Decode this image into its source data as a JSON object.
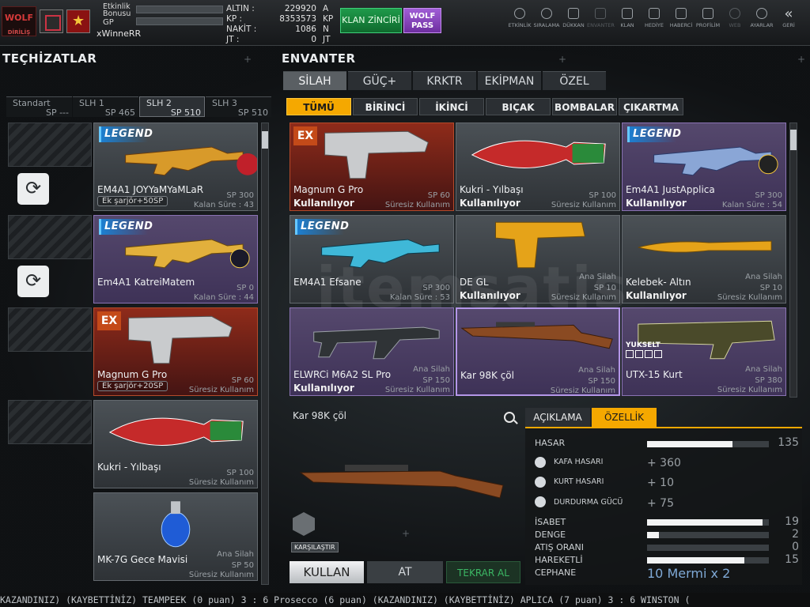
{
  "topbar": {
    "logo_text": "WOLF",
    "logo_sub": "DİRİLİŞ",
    "etkinlik_label": "Etkinlik Bonusu",
    "gp_label": "GP",
    "username": "xWinneRR",
    "currency": [
      {
        "label": "ALTIN :",
        "value": "229920",
        "unit": "A"
      },
      {
        "label": "KP :",
        "value": "8353573",
        "unit": "KP"
      },
      {
        "label": "NAKİT :",
        "value": "1086",
        "unit": "N"
      },
      {
        "label": "JT :",
        "value": "0",
        "unit": "JT"
      }
    ],
    "klan_button": "KLAN ZİNCİRİ",
    "wolf_pass": "WOLF PASS",
    "nav": [
      {
        "label": "ETKİNLİK",
        "icon": "clock-icon"
      },
      {
        "label": "SIRALAMA",
        "icon": "medal-icon"
      },
      {
        "label": "DÜKKAN",
        "icon": "cart-icon"
      },
      {
        "label": "ENVANTER",
        "icon": "inventory-icon"
      },
      {
        "label": "KLAN",
        "icon": "shield-icon"
      },
      {
        "label": "HEDİYE",
        "icon": "gift-icon"
      },
      {
        "label": "HABERCİ",
        "icon": "megaphone-icon"
      },
      {
        "label": "PROFİLİM",
        "icon": "profile-icon"
      },
      {
        "label": "WEB",
        "icon": "globe-icon"
      },
      {
        "label": "AYARLAR",
        "icon": "gear-icon"
      },
      {
        "label": "GERİ",
        "icon": "back-icon"
      }
    ]
  },
  "left": {
    "title": "TEÇHİZATLAR",
    "slot_tabs": [
      {
        "label": "Standart",
        "sp": "SP ---"
      },
      {
        "label": "SLH 1",
        "sp": "SP 465"
      },
      {
        "label": "SLH 2",
        "sp": "SP 510"
      },
      {
        "label": "SLH 3",
        "sp": "SP 510"
      }
    ],
    "items": [
      {
        "name": "EM4A1 JOYYaMYaMLaR",
        "extra": "Ek şarjör+50SP",
        "sp": "SP 300",
        "time": "Kalan Süre : 43",
        "tag": "LEGEND"
      },
      {
        "name": "Em4A1 KatreiMatem",
        "sp": "SP 0",
        "time": "Kalan Süre : 44",
        "tag": "LEGEND"
      },
      {
        "name": "Magnum G Pro",
        "extra": "Ek şarjör+20SP",
        "sp": "SP 60",
        "time": "Süresiz Kullanım",
        "tag": "EX"
      },
      {
        "name": "Kukri - Yılbaşı",
        "sp": "SP 100",
        "time": "Süresiz Kullanım"
      },
      {
        "name": "MK-7G Gece Mavisi",
        "cat": "Ana Silah",
        "sp": "SP 50",
        "time": "Süresiz Kullanım"
      }
    ]
  },
  "right": {
    "title": "ENVANTER",
    "tabs": [
      "SİLAH",
      "GÜÇ+",
      "KRKTR",
      "EKİPMAN",
      "ÖZEL"
    ],
    "sub_tabs": [
      "TÜMÜ",
      "BİRİNCİ",
      "İKİNCİ",
      "BIÇAK",
      "BOMBALAR",
      "ÇIKARTMA"
    ],
    "grid": [
      {
        "name": "Magnum G Pro",
        "sp": "SP 60",
        "status": "Kullanılıyor",
        "time": "Süresiz Kullanım",
        "tag": "EX"
      },
      {
        "name": "Kukri - Yılbaşı",
        "sp": "SP 100",
        "status": "Kullanılıyor",
        "time": "Süresiz Kullanım"
      },
      {
        "name": "Em4A1 JustApplica",
        "sp": "SP 300",
        "status": "Kullanılıyor",
        "time": "Kalan Süre : 54",
        "tag": "LEGEND"
      },
      {
        "name": "EM4A1 Efsane",
        "sp": "SP 300",
        "time": "Kalan Süre : 53",
        "tag": "LEGEND"
      },
      {
        "name": "DE GL",
        "cat": "Ana Silah",
        "sp": "SP 10",
        "status": "Kullanılıyor",
        "time": "Süresiz Kullanım"
      },
      {
        "name": "Kelebek- Altın",
        "cat": "Ana Silah",
        "sp": "SP 10",
        "status": "Kullanılıyor",
        "time": "Süresiz Kullanım"
      },
      {
        "name": "ELWRCi M6A2 SL Pro",
        "cat": "Ana Silah",
        "sp": "SP 150",
        "status": "Kullanılıyor",
        "time": "Süresiz Kullanım"
      },
      {
        "name": "Kar 98K çöl",
        "cat": "Ana Silah",
        "sp": "SP 150",
        "time": "Süresiz Kullanım"
      },
      {
        "name": "UTX-15 Kurt",
        "cat": "Ana Silah",
        "sp": "SP 380",
        "time": "Süresiz Kullanım",
        "tag": "YUKSELT"
      }
    ],
    "detail": {
      "name": "Kar 98K çöl",
      "compare": "KARŞILAŞTIR",
      "buttons": {
        "use": "KULLAN",
        "drop": "AT",
        "rebuy": "TEKRAR AL"
      },
      "desc_tabs": [
        "AÇIKLAMA",
        "ÖZELLİK"
      ],
      "stats": [
        {
          "label": "HASAR",
          "value": "135",
          "fill": 0.7
        },
        {
          "label": "KAFA HASARI",
          "bonus": "+ 360"
        },
        {
          "label": "KURT HASARI",
          "bonus": "+ 10"
        },
        {
          "label": "DURDURMA GÜCÜ",
          "bonus": "+ 75"
        },
        {
          "label": "İSABET",
          "value": "19",
          "fill": 0.95
        },
        {
          "label": "DENGE",
          "value": "2",
          "fill": 0.1
        },
        {
          "label": "ATIŞ ORANI",
          "value": "0",
          "fill": 0.0
        },
        {
          "label": "HAREKETLİ",
          "value": "15",
          "fill": 0.8
        },
        {
          "label": "CEPHANE",
          "ammo": "10 Mermi x 2"
        }
      ]
    }
  },
  "ticker": "KAZANDINIZ)        (KAYBETTİNİZ) TEAMPEEK (0 puan) 3 : 6 Prosecco (6 puan) (KAZANDINIZ)        (KAYBETTİNİZ) APLICA (7 puan) 3 : 6 WINSTON (",
  "watermark": "itemsatis"
}
